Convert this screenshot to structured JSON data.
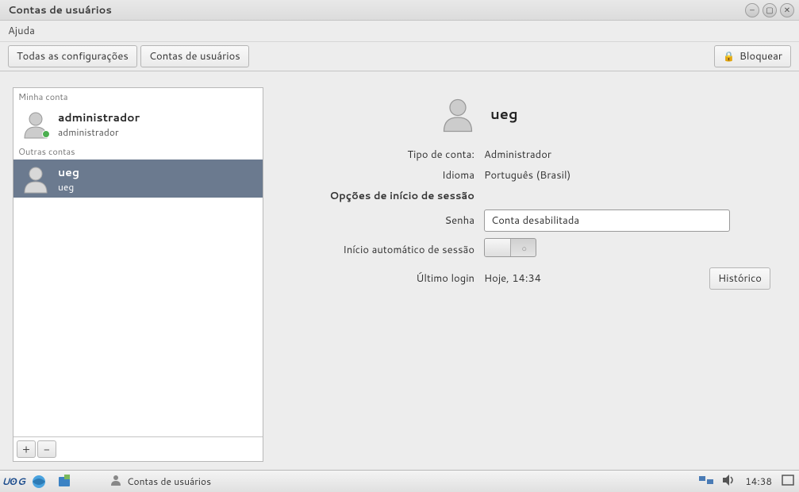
{
  "window": {
    "title": "Contas de usuários"
  },
  "menubar": {
    "help": "Ajuda"
  },
  "toolbar": {
    "all_settings": "Todas as configurações",
    "breadcrumb": "Contas de usuários",
    "lock": "Bloquear"
  },
  "sidebar": {
    "my_account_label": "Minha conta",
    "other_accounts_label": "Outras contas",
    "my_account": {
      "name": "administrador",
      "role": "administrador"
    },
    "other": [
      {
        "name": "ueg",
        "role": "ueg"
      }
    ]
  },
  "detail": {
    "selected_name": "ueg",
    "labels": {
      "account_type": "Tipo de conta:",
      "language": "Idioma",
      "login_options": "Opções de início de sessão",
      "password": "Senha",
      "autologin": "Início automático de sessão",
      "last_login": "Último login"
    },
    "values": {
      "account_type": "Administrador",
      "language": "Português (Brasil)",
      "password": "Conta desabilitada",
      "last_login": "Hoje, 14:34"
    },
    "history_button": "Histórico"
  },
  "taskbar": {
    "app_title": "Contas de usuários",
    "clock": "14:38"
  }
}
